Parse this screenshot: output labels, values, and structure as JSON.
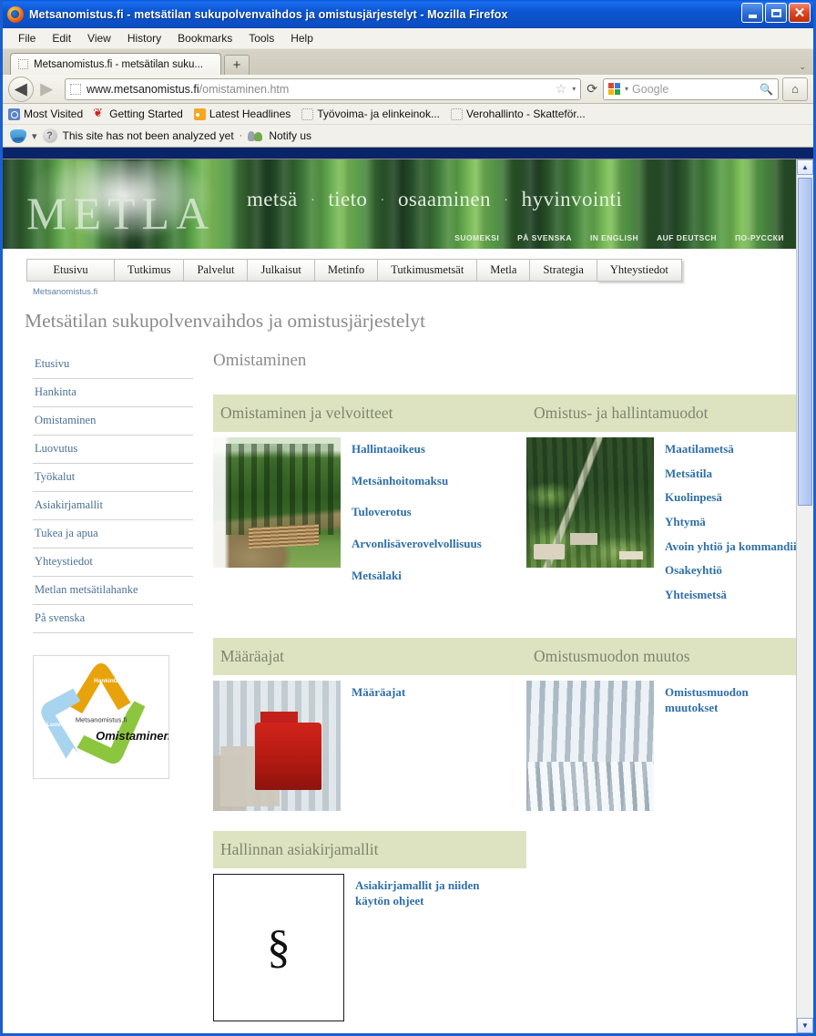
{
  "window": {
    "title": "Metsanomistus.fi - metsätilan sukupolvenvaihdos ja omistusjärjestelyt - Mozilla Firefox",
    "minimize_label": "Minimize",
    "maximize_label": "Maximize",
    "close_label": "Close"
  },
  "menubar": {
    "items": [
      {
        "label": "File"
      },
      {
        "label": "Edit"
      },
      {
        "label": "View"
      },
      {
        "label": "History"
      },
      {
        "label": "Bookmarks"
      },
      {
        "label": "Tools"
      },
      {
        "label": "Help"
      }
    ]
  },
  "tabbar": {
    "tab_title": "Metsanomistus.fi - metsätilan suku...",
    "new_tab_label": "+",
    "tab_list_label": "⌄"
  },
  "navbar": {
    "back_label": "◀",
    "forward_label": "▶",
    "url_domain": "www.metsanomistus.fi",
    "url_path": "/omistaminen.htm",
    "star_label": "☆",
    "caret_label": "▾",
    "reload_label": "⟳",
    "search_placeholder": "Google",
    "magnifier_label": "🔍",
    "home_label": "⌂"
  },
  "bookmarks": {
    "items": [
      {
        "label": "Most Visited",
        "icon": "mostvisited-icon"
      },
      {
        "label": "Getting Started",
        "icon": "getting-started-icon"
      },
      {
        "label": "Latest Headlines",
        "icon": "rss-icon"
      },
      {
        "label": "Työvoima- ja elinkeinok...",
        "icon": "blank-page-icon"
      },
      {
        "label": "Verohallinto - Skatteför...",
        "icon": "blank-page-icon"
      }
    ]
  },
  "wotbar": {
    "caret": "▾",
    "question_mark": "?",
    "status_text": "This site has not been analyzed yet",
    "dot": "·",
    "notify_label": "Notify us"
  },
  "banner": {
    "logo_text": "METLA",
    "tagline_words": [
      "metsä",
      "tieto",
      "osaaminen",
      "hyvinvointi"
    ],
    "tagline_separator": "·",
    "languages": [
      "SUOMEKSI",
      "PÅ SVENSKA",
      "IN ENGLISH",
      "AUF DEUTSCH",
      "ПО-РУССКИ"
    ]
  },
  "navtabs": {
    "items": [
      {
        "label": "Etusivu"
      },
      {
        "label": "Tutkimus"
      },
      {
        "label": "Palvelut"
      },
      {
        "label": "Julkaisut"
      },
      {
        "label": "Metinfo"
      },
      {
        "label": "Tutkimusmetsät"
      },
      {
        "label": "Metla"
      },
      {
        "label": "Strategia"
      },
      {
        "label": "Yhteystiedot"
      }
    ]
  },
  "breadcrumb": {
    "text": "Metsanomistus.fi"
  },
  "page": {
    "title": "Metsätilan sukupolvenvaihdos ja omistusjärjestelyt",
    "section_heading": "Omistaminen"
  },
  "sidebar": {
    "items": [
      {
        "label": "Etusivu"
      },
      {
        "label": "Hankinta"
      },
      {
        "label": "Omistaminen"
      },
      {
        "label": "Luovutus"
      },
      {
        "label": "Työkalut"
      },
      {
        "label": "Asiakirjamallit"
      },
      {
        "label": "Tukea ja apua"
      },
      {
        "label": "Yhteystiedot"
      },
      {
        "label": "Metlan metsätilahanke"
      },
      {
        "label": "På svenska"
      }
    ],
    "diagram": {
      "center_label": "Metsanomistus.fi",
      "highlight_label": "Omistaminen",
      "arrow_top": "Hankinta",
      "arrow_right": "Omistaminen",
      "arrow_left": "Luovutus",
      "color_top": "#e8a30c",
      "color_right": "#8cc63f",
      "color_left": "#a8d4f0"
    }
  },
  "main": {
    "sections": [
      {
        "band_left": "Omistaminen ja velvoitteet",
        "band_right": "Omistus- ja hallintamuodot",
        "left_image": "forest-road-photo",
        "right_image": "aerial-farmland-photo",
        "left_links": [
          "Hallintaoikeus",
          "Metsänhoitomaksu",
          "Tuloverotus",
          "Arvonlisäverovelvollisuus",
          "Metsälaki"
        ],
        "right_links": [
          "Maatilametsä",
          "Metsätila",
          "Kuolinpesä",
          "Yhtymä",
          "Avoin yhtiö ja kommandiittiyhtiö",
          "Osakeyhtiö",
          "Yhteismetsä"
        ]
      },
      {
        "band_left": "Määräajat",
        "band_right": "Omistusmuodon muutos",
        "left_image": "logging-truck-snow-photo",
        "right_image": "snowy-forest-photo",
        "left_links": [
          "Määräajat"
        ],
        "right_links": [
          "Omistusmuodon muutokset"
        ]
      },
      {
        "band_left": "Hallinnan asiakirjamallit",
        "band_right": "",
        "left_image": "paragraph-sign-image",
        "paragraph_glyph": "§",
        "left_links": [
          "Asiakirjamallit ja niiden käytön ohjeet"
        ],
        "right_links": []
      }
    ]
  },
  "scrollbar": {
    "up_arrow": "▲",
    "down_arrow": "▼"
  },
  "colors": {
    "band_green": "#dde3c0",
    "link_blue": "#2f6fa8",
    "sidebar_link": "#4a6f96",
    "heading_gray": "#8b8b8b"
  }
}
